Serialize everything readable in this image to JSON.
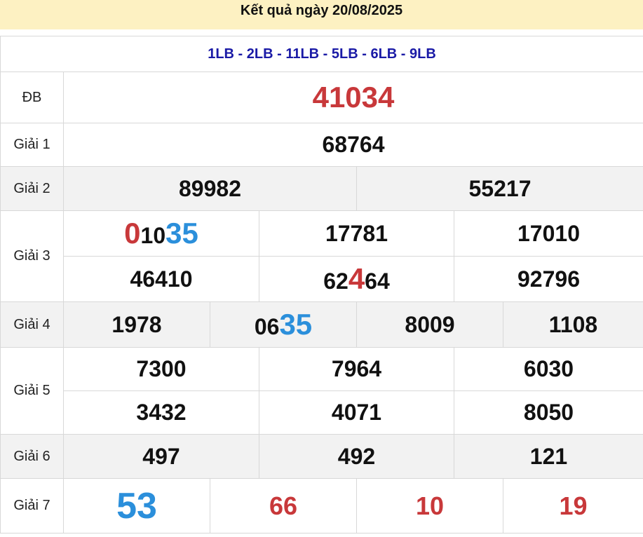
{
  "header": {
    "title": "Kết quả ngày 20/08/2025"
  },
  "codes": "1LB - 2LB - 11LB - 5LB - 6LB - 9LB",
  "labels": {
    "db": "ĐB",
    "g1": "Giải 1",
    "g2": "Giải 2",
    "g3": "Giải 3",
    "g4": "Giải 4",
    "g5": "Giải 5",
    "g6": "Giải 6",
    "g7": "Giải 7"
  },
  "results": {
    "db": "41034",
    "g1": "68764",
    "g2": [
      "89982",
      "55217"
    ],
    "g3_a": {
      "p1": "0",
      "p2": "10",
      "p3": "35"
    },
    "g3": [
      "17781",
      "17010",
      "46410",
      "92796"
    ],
    "g3_b": {
      "p1": "62",
      "p2": "4",
      "p3": "64"
    },
    "g4_a": "1978",
    "g4_b": {
      "p1": "06",
      "p2": "35"
    },
    "g4": [
      "8009",
      "1108"
    ],
    "g5": [
      "7300",
      "7964",
      "6030",
      "3432",
      "4071",
      "8050"
    ],
    "g6": [
      "497",
      "492",
      "121"
    ],
    "g7": [
      "53",
      "66",
      "10",
      "19"
    ]
  },
  "colors": {
    "red": "#c8383a",
    "blue": "#2b8fdb",
    "header_bg": "#fdf1c2",
    "code_text": "#1a1aa6"
  }
}
